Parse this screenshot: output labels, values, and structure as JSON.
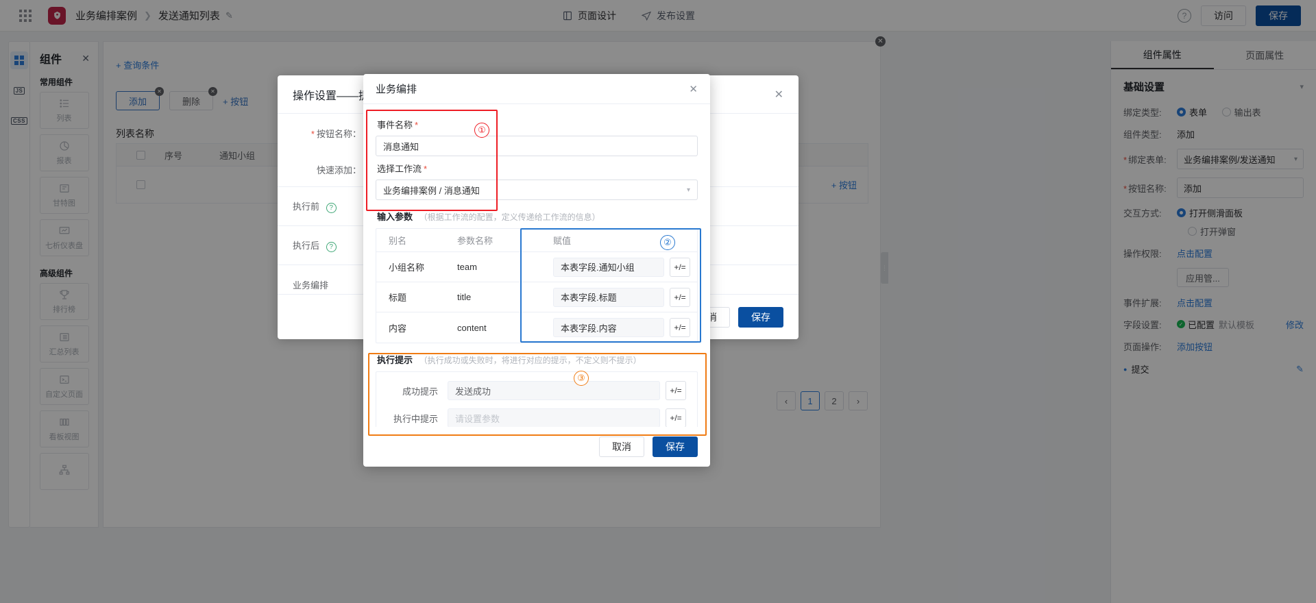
{
  "topbar": {
    "app_name": "业务编排案例",
    "breadcrumb_current": "发送通知列表",
    "nav": [
      {
        "label": "页面设计",
        "icon": "layout-icon"
      },
      {
        "label": "发布设置",
        "icon": "send-icon"
      }
    ],
    "help_label": "?",
    "visit_label": "访问",
    "save_label": "保存"
  },
  "left_rail": {
    "items": [
      {
        "name": "components",
        "label": ""
      },
      {
        "name": "js",
        "label": "JS"
      },
      {
        "name": "css",
        "label": "CSS"
      }
    ]
  },
  "components_panel": {
    "title": "组件",
    "close": "✕",
    "groups": [
      {
        "title": "常用组件",
        "items": [
          {
            "label": "列表",
            "icon": "list-icon"
          },
          {
            "label": "报表",
            "icon": "pie-chart-icon"
          },
          {
            "label": "甘特图",
            "icon": "gantt-icon"
          },
          {
            "label": "七析仪表盘",
            "icon": "dashboard-icon"
          }
        ]
      },
      {
        "title": "高级组件",
        "items": [
          {
            "label": "排行榜",
            "icon": "trophy-icon"
          },
          {
            "label": "汇总列表",
            "icon": "summary-list-icon"
          },
          {
            "label": "自定义页面",
            "icon": "terminal-icon"
          },
          {
            "label": "看板视图",
            "icon": "kanban-icon"
          },
          {
            "label": "",
            "icon": "org-chart-icon"
          }
        ]
      }
    ]
  },
  "canvas": {
    "query_condition": "+ 查询条件",
    "buttons": [
      {
        "label": "添加",
        "badge": "✕"
      },
      {
        "label": "删除",
        "badge": "✕"
      }
    ],
    "add_button_link": "+ 按钮",
    "list_title": "列表名称",
    "table": {
      "headers": [
        "",
        "序号",
        "通知小组",
        ""
      ],
      "rows": [
        {
          "index": "",
          "group": "",
          "action": "+ 按钮"
        }
      ],
      "row_action_link": "+ 按钮"
    },
    "pager": {
      "prev": "‹",
      "pages": [
        "1",
        "2"
      ],
      "next": "›",
      "active": "1"
    }
  },
  "op_dialog": {
    "title": "操作设置——提",
    "close": "✕",
    "rows": [
      {
        "label": "按钮名称：",
        "required": true,
        "value": ""
      },
      {
        "label": "快速添加：",
        "required": false,
        "value": ""
      },
      {
        "label": "执行前",
        "required": false,
        "value": "",
        "has_help": true
      },
      {
        "label": "执行后",
        "required": false,
        "value": "",
        "has_help": true
      },
      {
        "label": "业务编排",
        "required": false,
        "value": ""
      }
    ],
    "cancel_label": "取消",
    "save_label": "保存"
  },
  "wf_dialog": {
    "title": "业务编排",
    "close": "✕",
    "event_name_label": "事件名称",
    "event_name_value": "消息通知",
    "workflow_label": "选择工作流",
    "workflow_value": "业务编排案例 / 消息通知",
    "input_params_label": "输入参数",
    "input_params_hint": "（根据工作流的配置，定义传递给工作流的信息）",
    "param_table": {
      "headers": [
        "别名",
        "参数名称",
        "赋值"
      ],
      "rows": [
        {
          "alias": "小组名称",
          "param": "team",
          "value": "本表字段.通知小组",
          "action": "+/="
        },
        {
          "alias": "标题",
          "param": "title",
          "value": "本表字段.标题",
          "action": "+/="
        },
        {
          "alias": "内容",
          "param": "content",
          "value": "本表字段.内容",
          "action": "+/="
        }
      ]
    },
    "exec_prompt_label": "执行提示",
    "exec_prompt_hint": "（执行成功或失败时，将进行对应的提示，不定义则不提示）",
    "prompt_rows": [
      {
        "label": "成功提示",
        "value": "发送成功",
        "placeholder": "",
        "action": "+/="
      },
      {
        "label": "执行中提示",
        "value": "",
        "placeholder": "请设置参数",
        "action": "+/="
      }
    ],
    "cancel_label": "取消",
    "save_label": "保存"
  },
  "annotations": [
    {
      "num": "①",
      "color": "#ee1c24"
    },
    {
      "num": "②",
      "color": "#2878d0"
    },
    {
      "num": "③",
      "color": "#f07c14"
    }
  ],
  "props_panel": {
    "tabs": [
      {
        "label": "组件属性",
        "active": true
      },
      {
        "label": "页面属性",
        "active": false
      }
    ],
    "section_title": "基础设置",
    "bind_type_label": "绑定类型:",
    "bind_type_options": [
      {
        "label": "表单",
        "selected": true
      },
      {
        "label": "输出表",
        "selected": false
      }
    ],
    "comp_type_label": "组件类型:",
    "comp_type_value": "添加",
    "bind_form_label": "绑定表单:",
    "bind_form_value": "业务编排案例/发送通知",
    "btn_name_label": "按钮名称:",
    "btn_name_value": "添加",
    "interaction_label": "交互方式:",
    "interaction_options": [
      {
        "label": "打开侧滑面板",
        "selected": true
      },
      {
        "label": "打开弹窗",
        "selected": false
      }
    ],
    "op_perm_label": "操作权限:",
    "op_perm_link": "点击配置",
    "app_mgr_button": "应用管...",
    "event_ext_label": "事件扩展:",
    "event_ext_link": "点击配置",
    "field_set_label": "字段设置:",
    "field_set_status": "已配置",
    "field_set_sub": "默认模板",
    "field_set_action": "修改",
    "page_op_label": "页面操作:",
    "page_op_link": "添加按钮",
    "page_op_item": "提交"
  },
  "colors": {
    "primary": "#0a4fa0",
    "link": "#2d7ddb",
    "anno_red": "#ee1c24",
    "anno_blue": "#2878d0",
    "anno_orange": "#f07c14",
    "brand": "#c0254a"
  }
}
